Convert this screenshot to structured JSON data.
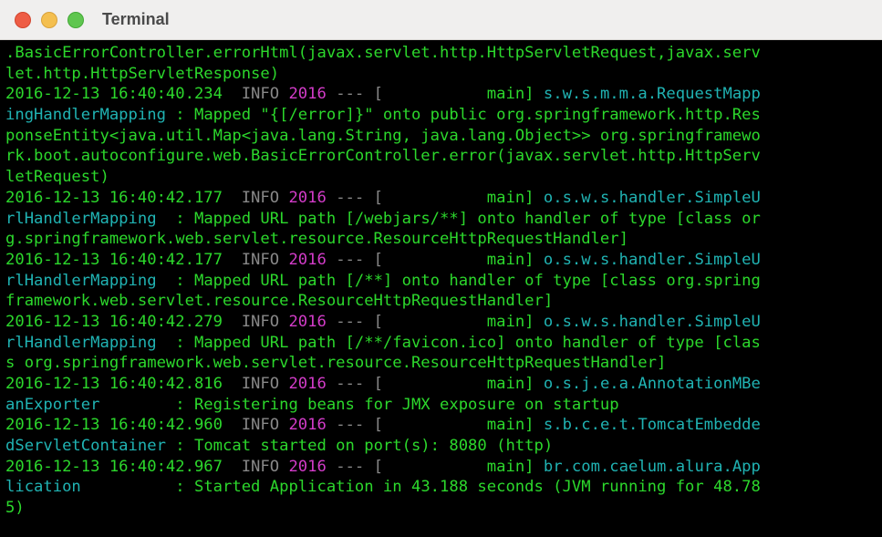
{
  "window": {
    "title": "Terminal"
  },
  "colors": {
    "background": "#000000",
    "text_green": "#2cd82c",
    "info_gray": "#888888",
    "pid_magenta": "#d33cc9",
    "logger_cyan": "#20b3b3"
  },
  "terminal": {
    "lines": [
      [
        {
          "t": ".BasicErrorController.errorHtml(javax.servlet.http.HttpServletRequest,javax.serv",
          "c": "green"
        }
      ],
      [
        {
          "t": "let.http.HttpServletResponse)",
          "c": "green"
        }
      ],
      [
        {
          "t": "2016-12-13 16:40:40.234  ",
          "c": "green"
        },
        {
          "t": "INFO ",
          "c": "info"
        },
        {
          "t": "2016",
          "c": "pid"
        },
        {
          "t": " --- [           ",
          "c": "dim"
        },
        {
          "t": "main] ",
          "c": "green"
        },
        {
          "t": "s.w.s.m.m.a.RequestMapp",
          "c": "cls"
        }
      ],
      [
        {
          "t": "ingHandlerMapping",
          "c": "cls"
        },
        {
          "t": " : Mapped \"{[/error]}\" onto public org.springframework.http.Res",
          "c": "green"
        }
      ],
      [
        {
          "t": "ponseEntity<java.util.Map<java.lang.String, java.lang.Object>> org.springframewo",
          "c": "green"
        }
      ],
      [
        {
          "t": "rk.boot.autoconfigure.web.BasicErrorController.error(javax.servlet.http.HttpServ",
          "c": "green"
        }
      ],
      [
        {
          "t": "letRequest)",
          "c": "green"
        }
      ],
      [
        {
          "t": "2016-12-13 16:40:42.177  ",
          "c": "green"
        },
        {
          "t": "INFO ",
          "c": "info"
        },
        {
          "t": "2016",
          "c": "pid"
        },
        {
          "t": " --- [           ",
          "c": "dim"
        },
        {
          "t": "main] ",
          "c": "green"
        },
        {
          "t": "o.s.w.s.handler.SimpleU",
          "c": "cls"
        }
      ],
      [
        {
          "t": "rlHandlerMapping",
          "c": "cls"
        },
        {
          "t": "  : Mapped URL path [/webjars/**] onto handler of type [class or",
          "c": "green"
        }
      ],
      [
        {
          "t": "g.springframework.web.servlet.resource.ResourceHttpRequestHandler]",
          "c": "green"
        }
      ],
      [
        {
          "t": "2016-12-13 16:40:42.177  ",
          "c": "green"
        },
        {
          "t": "INFO ",
          "c": "info"
        },
        {
          "t": "2016",
          "c": "pid"
        },
        {
          "t": " --- [           ",
          "c": "dim"
        },
        {
          "t": "main] ",
          "c": "green"
        },
        {
          "t": "o.s.w.s.handler.SimpleU",
          "c": "cls"
        }
      ],
      [
        {
          "t": "rlHandlerMapping",
          "c": "cls"
        },
        {
          "t": "  : Mapped URL path [/**] onto handler of type [class org.spring",
          "c": "green"
        }
      ],
      [
        {
          "t": "framework.web.servlet.resource.ResourceHttpRequestHandler]",
          "c": "green"
        }
      ],
      [
        {
          "t": "2016-12-13 16:40:42.279  ",
          "c": "green"
        },
        {
          "t": "INFO ",
          "c": "info"
        },
        {
          "t": "2016",
          "c": "pid"
        },
        {
          "t": " --- [           ",
          "c": "dim"
        },
        {
          "t": "main] ",
          "c": "green"
        },
        {
          "t": "o.s.w.s.handler.SimpleU",
          "c": "cls"
        }
      ],
      [
        {
          "t": "rlHandlerMapping",
          "c": "cls"
        },
        {
          "t": "  : Mapped URL path [/**/favicon.ico] onto handler of type [clas",
          "c": "green"
        }
      ],
      [
        {
          "t": "s org.springframework.web.servlet.resource.ResourceHttpRequestHandler]",
          "c": "green"
        }
      ],
      [
        {
          "t": "2016-12-13 16:40:42.816  ",
          "c": "green"
        },
        {
          "t": "INFO ",
          "c": "info"
        },
        {
          "t": "2016",
          "c": "pid"
        },
        {
          "t": " --- [           ",
          "c": "dim"
        },
        {
          "t": "main] ",
          "c": "green"
        },
        {
          "t": "o.s.j.e.a.AnnotationMBe",
          "c": "cls"
        }
      ],
      [
        {
          "t": "anExporter",
          "c": "cls"
        },
        {
          "t": "        : Registering beans for JMX exposure on startup",
          "c": "green"
        }
      ],
      [
        {
          "t": "2016-12-13 16:40:42.960  ",
          "c": "green"
        },
        {
          "t": "INFO ",
          "c": "info"
        },
        {
          "t": "2016",
          "c": "pid"
        },
        {
          "t": " --- [           ",
          "c": "dim"
        },
        {
          "t": "main] ",
          "c": "green"
        },
        {
          "t": "s.b.c.e.t.TomcatEmbedde",
          "c": "cls"
        }
      ],
      [
        {
          "t": "dServletContainer",
          "c": "cls"
        },
        {
          "t": " : Tomcat started on port(s): 8080 (http)",
          "c": "green"
        }
      ],
      [
        {
          "t": "2016-12-13 16:40:42.967  ",
          "c": "green"
        },
        {
          "t": "INFO ",
          "c": "info"
        },
        {
          "t": "2016",
          "c": "pid"
        },
        {
          "t": " --- [           ",
          "c": "dim"
        },
        {
          "t": "main] ",
          "c": "green"
        },
        {
          "t": "br.com.caelum.alura.App",
          "c": "cls"
        }
      ],
      [
        {
          "t": "lication",
          "c": "cls"
        },
        {
          "t": "          : Started Application in 43.188 seconds (JVM running for 48.78",
          "c": "green"
        }
      ],
      [
        {
          "t": "5)",
          "c": "green"
        }
      ]
    ]
  }
}
